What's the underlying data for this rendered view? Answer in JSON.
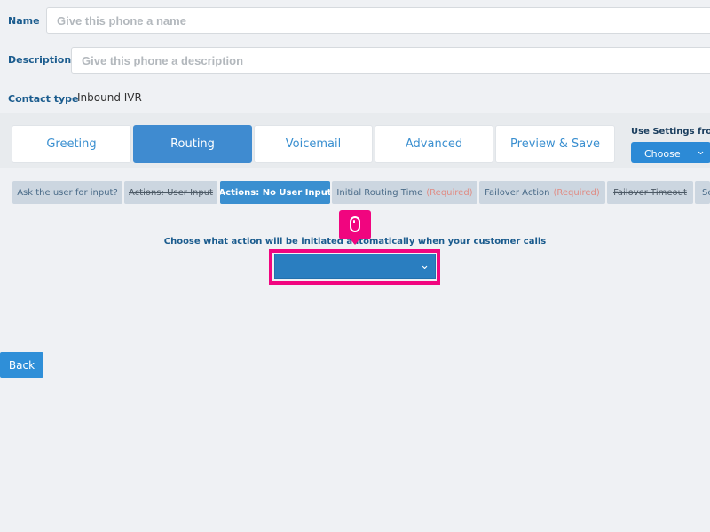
{
  "form": {
    "name_label": "Name",
    "name_placeholder": "Give this phone a name",
    "description_label": "Description",
    "description_placeholder": "Give this phone a description",
    "contact_type_label": "Contact type",
    "contact_type_value": "Inbound IVR"
  },
  "tabs": [
    {
      "label": "Greeting",
      "active": false
    },
    {
      "label": "Routing",
      "active": true
    },
    {
      "label": "Voicemail",
      "active": false
    },
    {
      "label": "Advanced",
      "active": false
    },
    {
      "label": "Preview & Save",
      "active": false
    }
  ],
  "use_settings": {
    "label": "Use Settings from",
    "button_label": "Choose",
    "icon": "chevron-down-icon"
  },
  "subtabs": [
    {
      "label": "Ask the user for input?",
      "state": "normal",
      "required": ""
    },
    {
      "label": "Actions: User Input",
      "state": "struck",
      "required": ""
    },
    {
      "label": "Actions: No User Input",
      "state": "active",
      "required": ""
    },
    {
      "label": "Initial Routing Time",
      "state": "normal",
      "required": "(Required)"
    },
    {
      "label": "Failover Action",
      "state": "normal",
      "required": "(Required)"
    },
    {
      "label": "Failover Timeout",
      "state": "struck",
      "required": ""
    },
    {
      "label": "Se",
      "state": "normal",
      "required": ""
    }
  ],
  "main": {
    "prompt": "Choose what action will be initiated automatically when your customer calls",
    "select_value": "",
    "select_icon": "chevron-down-icon",
    "cursor_icon": "mouse-icon"
  },
  "footer": {
    "back_label": "Back"
  },
  "colors": {
    "accent": "#3f8bd0",
    "highlight": "#f1057f",
    "required": "#e08b83"
  }
}
